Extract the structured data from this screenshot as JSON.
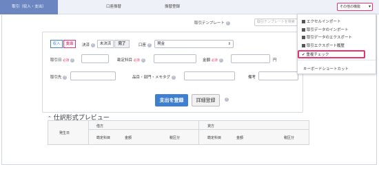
{
  "tabs": [
    {
      "label": "取引（収入・支出）",
      "active": true
    },
    {
      "label": "口座振替",
      "active": false
    },
    {
      "label": "振替登録",
      "active": false
    }
  ],
  "other_functions_button": "その他の機能",
  "template": {
    "label": "取引テンプレート",
    "placeholder": "取引テンプレートを検索"
  },
  "form": {
    "income_label": "収入",
    "expense_label": "支出",
    "settlement_label": "決済",
    "unsettled_label": "未決済",
    "settled_label": "完了",
    "account_label": "口座",
    "account_value": "現金",
    "date_label": "取引日",
    "item_label": "勘定科目",
    "amount_label": "金額",
    "required_mark": "必須",
    "yen_label": "円",
    "partner_label": "取引先",
    "tags_label": "品目・部門・メモタグ",
    "note_label": "備考",
    "register_button": "支出を登録",
    "detail_button": "詳細登録"
  },
  "preview": {
    "title": "仕訳形式プレビュー",
    "date_col": "発生日",
    "debit_header": "借方",
    "credit_header": "貸方",
    "columns": [
      "勘定科目",
      "金額",
      "税区分",
      "勘定科目",
      "金額",
      "税区分"
    ]
  },
  "menu": {
    "items": [
      {
        "label": "エクセルインポート"
      },
      {
        "label": "取引データのインポート"
      },
      {
        "label": "取引データのエクスポート"
      },
      {
        "label": "取引エクスポート履歴"
      },
      {
        "label": "重複チェック",
        "checked": true
      },
      {
        "label": "キーボードショートカット"
      }
    ],
    "check_mark": "✔"
  },
  "colors": {
    "accent": "#e8336d",
    "primary": "#3f7fd1",
    "tab_active": "#6c86c2"
  }
}
